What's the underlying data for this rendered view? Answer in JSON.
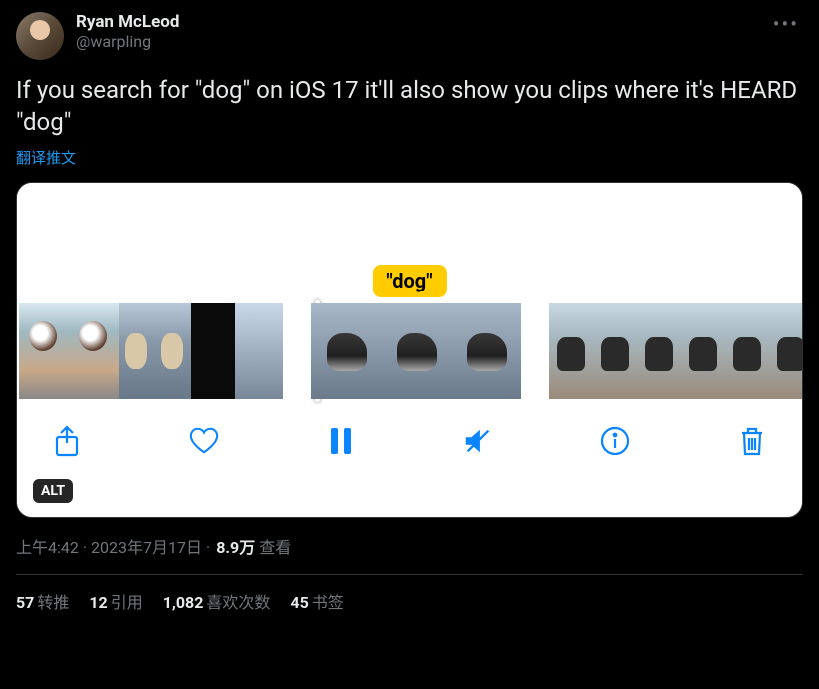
{
  "author": {
    "display_name": "Ryan McLeod",
    "handle": "@warpling"
  },
  "body_text": "If you search for \"dog\" on iOS 17 it'll also show you clips where it's HEARD \"dog\"",
  "translate_label": "翻译推文",
  "media": {
    "highlight_label": "\"dog\"",
    "alt_badge": "ALT"
  },
  "meta": {
    "time": "上午4:42",
    "date": "2023年7月17日",
    "views_count": "8.9万",
    "views_label": "查看",
    "separator": " · "
  },
  "stats": {
    "retweets": {
      "count": "57",
      "label": "转推"
    },
    "quotes": {
      "count": "12",
      "label": "引用"
    },
    "likes": {
      "count": "1,082",
      "label": "喜欢次数"
    },
    "bookmarks": {
      "count": "45",
      "label": "书签"
    }
  }
}
